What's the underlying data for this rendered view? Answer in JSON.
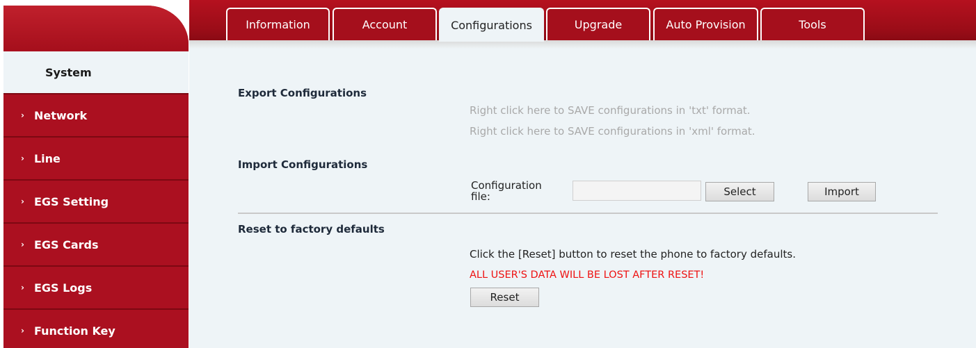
{
  "tabs": [
    {
      "label": "Information"
    },
    {
      "label": "Account"
    },
    {
      "label": "Configurations"
    },
    {
      "label": "Upgrade"
    },
    {
      "label": "Auto Provision"
    },
    {
      "label": "Tools"
    }
  ],
  "active_tab": "Configurations",
  "sidebar": {
    "items": [
      {
        "label": "System",
        "icon": "none"
      },
      {
        "label": "Network",
        "icon": "chevron-right"
      },
      {
        "label": "Line",
        "icon": "chevron-right"
      },
      {
        "label": "EGS Setting",
        "icon": "chevron-right"
      },
      {
        "label": "EGS Cards",
        "icon": "chevron-right"
      },
      {
        "label": "EGS Logs",
        "icon": "chevron-right"
      },
      {
        "label": "Function Key",
        "icon": "chevron-right"
      }
    ],
    "chevron": "›",
    "active": "System"
  },
  "export": {
    "title": "Export Configurations",
    "txt_link": "Right click here to SAVE configurations in 'txt' format.",
    "xml_link": "Right click here to SAVE configurations in 'xml' format."
  },
  "import": {
    "title": "Import Configurations",
    "file_label_line1": "Configuration",
    "file_label_line2": "file:",
    "file_value": "",
    "select_label": "Select",
    "import_label": "Import"
  },
  "reset": {
    "title": "Reset to factory defaults",
    "description": "Click the [Reset] button to reset the phone to factory defaults.",
    "warning": "ALL USER'S DATA WILL BE LOST AFTER RESET!",
    "button_label": "Reset"
  },
  "colors": {
    "brand_red": "#a50f1c",
    "content_bg": "#eef4f7",
    "warning_red": "#ee1111",
    "link_gray": "#a9a9a9"
  }
}
